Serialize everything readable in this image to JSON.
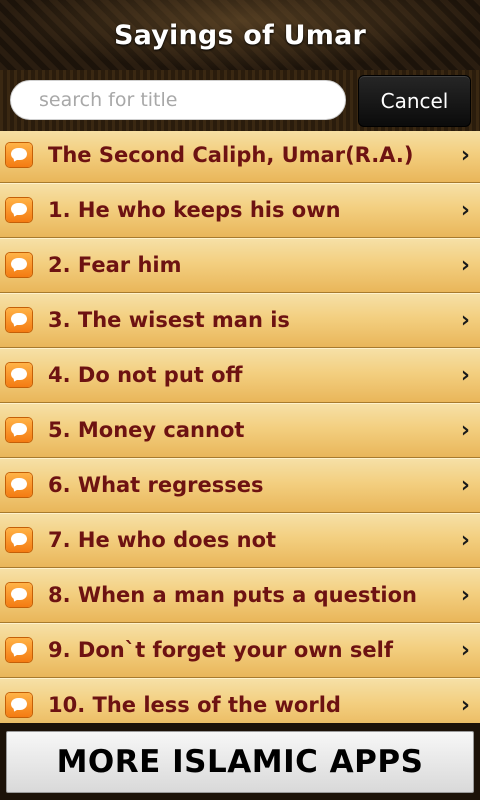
{
  "header": {
    "title": "Sayings of Umar"
  },
  "search": {
    "placeholder": "search for title",
    "value": ""
  },
  "cancel_label": "Cancel",
  "list": {
    "items": [
      {
        "label": "The Second Caliph, Umar(R.A.)"
      },
      {
        "label": "1. He who keeps his own"
      },
      {
        "label": "2. Fear him"
      },
      {
        "label": "3. The wisest man is"
      },
      {
        "label": "4. Do not put off"
      },
      {
        "label": "5. Money cannot"
      },
      {
        "label": "6. What regresses"
      },
      {
        "label": "7. He who does not"
      },
      {
        "label": "8. When a man puts a question"
      },
      {
        "label": "9. Don`t forget your own self"
      },
      {
        "label": "10. The less of the world"
      }
    ],
    "chevron": "›",
    "icon": "speech-bubble-icon"
  },
  "footer": {
    "button_label": "MORE ISLAMIC APPS"
  },
  "colors": {
    "item_text": "#6d1212",
    "item_background": "#f3cf80",
    "icon_orange": "#f47b12"
  }
}
